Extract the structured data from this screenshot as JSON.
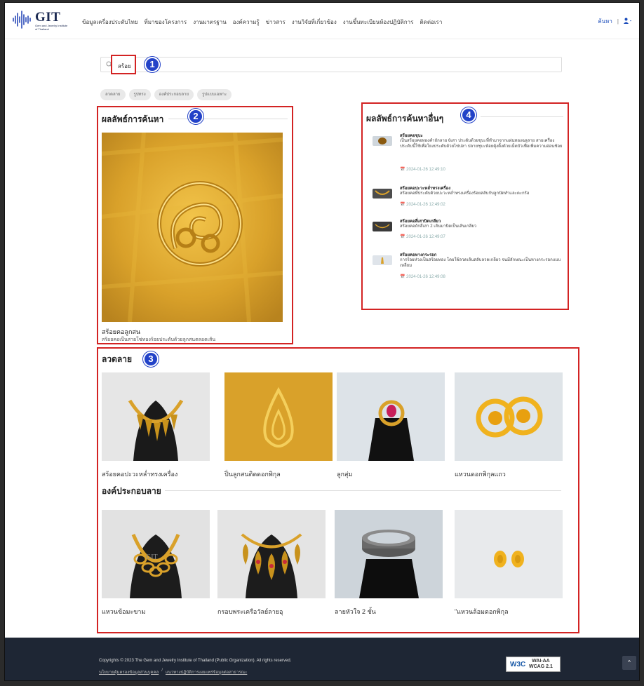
{
  "header": {
    "brand": "GIT",
    "brand_sub": "Gem and Jewelry Institute of Thailand",
    "nav": [
      "ข้อมูลเครื่องประดับไทย",
      "ที่มาของโครงการ",
      "งานมาตรฐาน",
      "องค์ความรู้",
      "ข่าวสาร",
      "งานวิจัยที่เกี่ยวข้อง",
      "งานขึ้นทะเบียนห้องปฏิบัติการ",
      "ติดต่อเรา"
    ],
    "search_link": "ค้นหา",
    "separator": "|"
  },
  "search": {
    "term": "สร้อย"
  },
  "badges": [
    "1",
    "2",
    "3",
    "4"
  ],
  "filters": [
    "ลวดลาย",
    "รูปทรง",
    "องค์ประกอบลาย",
    "รูปแบบเฉพาะ"
  ],
  "main_result": {
    "section_title": "ผลลัพธ์การค้นหา",
    "name": "สร้อยคอลูกสน",
    "desc": "สร้อยคอเป็นสายโซ่ทองร้อยประดับด้วยลูกสนตลอดเส้น"
  },
  "other_results": {
    "section_title": "ผลลัพธ์การค้นหาอื่นๆ",
    "items": [
      {
        "title": "สร้อยคอชุบะ",
        "desc": "เป็นสร้อยคอทองคำถักลาย 6เสา ประดับด้วยชุบะที่ทำมาจากแผ่นทองฉลุลาย สายเครื่องประดับนี้ใช้เพื่อโยงประดับด้วยไข่ปลา ปลายชุบะห้อยตุ้งติ้งด้วยเม็ดบัวเพื่อเพิ่มความอ่อนช้อย",
        "date": "2024-01-26 12:49:10"
      },
      {
        "title": "สร้อยคอปะวะหล่ำทรงเครื่อง",
        "desc": "สร้อยคอที่ประดับด้วยปะวะหล่ำทรงเครื่องร้อยสลับกับลูกปัดทำและตะกร้อ",
        "date": "2024-01-26 12:49:02"
      },
      {
        "title": "สร้อยคอสี่เสาบิดเกลียว",
        "desc": "สร้อยคอถักสี่เสา 2 เส้นมาบิดเป็นเส้นเกลียว",
        "date": "2024-01-26 12:49:07"
      },
      {
        "title": "สร้อยคอหางกระรอก",
        "desc": "การร้อยห่วงเป็นสร้อยทอง โดยใช้ลวดเส้นสลับลวดเกลียว จนมีลักษณะเป็นหางกระรอกแบบเหลี่ยม",
        "date": "2024-01-26 12:49:08"
      }
    ]
  },
  "pattern_section": {
    "title": "ลวดลาย",
    "items": [
      "สร้อยคอปะวะหล่ำทรงเครื่อง",
      "ปิ่นลูกสนติดดอกพิกุล",
      "ลูกสุ่ม",
      "แหวนดอกพิกุลแถว"
    ]
  },
  "component_section": {
    "title": "องค์ประกอบลาย",
    "items": [
      "แหวนข้อมะขาม",
      "กรอบพระเครือวัลย์ลายอุ",
      "ลายหัวใจ 2 ชั้น",
      "\"แหวนล้อมดอกพิกุล"
    ]
  },
  "footer": {
    "copyright": "Copyrights © 2023 The Gem and Jewelry Institute of Thailand (Public Organization). All rights reserved.",
    "link1": "นโยบายคุ้มครองข้อมูลส่วนบุคคล",
    "link_sep": "/",
    "link2": "แนวทางปฏิบัติการเผยแพร่ข้อมูลต่อสาธารณะ",
    "wcag_logo": "W3C",
    "wcag_line1": "WAI-AA",
    "wcag_line2": "WCAG 2.1",
    "totop": "^"
  },
  "colors": {
    "highlight": "#d32323",
    "badge": "#2242c8",
    "footer_bg": "#1e2634"
  }
}
